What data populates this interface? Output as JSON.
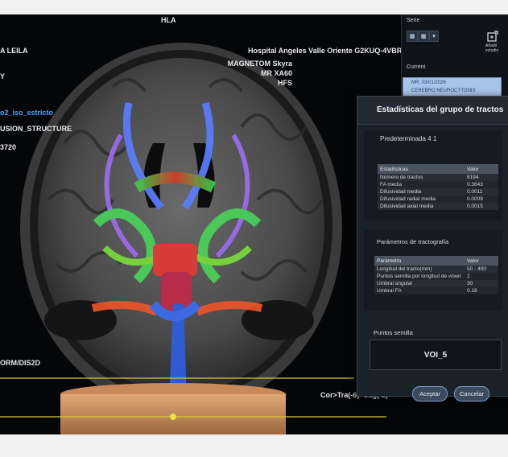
{
  "viewport": {
    "orientation_top": "HLA",
    "patient_name": "A LEILA",
    "side_letter": "Y",
    "series_link": "o2_iso_estricto",
    "fusion_label": "USION_STRUCTURE",
    "number_label": "3720",
    "form_label": "ORM/DIS2D",
    "hospital": "Hospital Angeles Valle Oriente G2KUQ-4VBRK",
    "scanner_model": "MAGNETOM Skyra",
    "sequence": "MR XA60",
    "position": "HFS",
    "orientation_bottom": "Cor>Tra(-6)>Sag(-2)"
  },
  "serie_panel": {
    "serie_label": "Serie",
    "add_study_line1": "Añadir",
    "add_study_line2": "estudio",
    "current_label": "Current",
    "current_item_line1": "MR, 03/01/2026",
    "current_item_line2": "CEREBRO NEUROCYTONIX",
    "icons": [
      "grid-icon",
      "dropdown-icon",
      "add-study-icon"
    ]
  },
  "dialog": {
    "title": "Estadísticas del grupo de tractos",
    "preset": "Predeterminada 4 1",
    "stats_table": {
      "headers": [
        "Estadísticas",
        "Valor"
      ],
      "rows": [
        [
          "Número de tractos",
          "8194"
        ],
        [
          "FA media",
          "0.3643"
        ],
        [
          "Difusividad media",
          "0.0011"
        ],
        [
          "Difusividad radial media",
          "0.0009"
        ],
        [
          "Difusividad axial media",
          "0.0015"
        ]
      ]
    },
    "params_label": "Parámetros de tractografía",
    "params_table": {
      "headers": [
        "Parámetro",
        "Valor"
      ],
      "rows": [
        [
          "Longitud del tracto(mm)",
          "50 - 400"
        ],
        [
          "Puntos semilla por longitud de vóxel",
          "2"
        ],
        [
          "Umbral angular",
          "30"
        ],
        [
          "Umbral FA",
          "0.18"
        ]
      ]
    },
    "seed_label": "Puntos semilla",
    "seed_value": "VOI_5",
    "accept": "Aceptar",
    "cancel": "Cancelar"
  }
}
